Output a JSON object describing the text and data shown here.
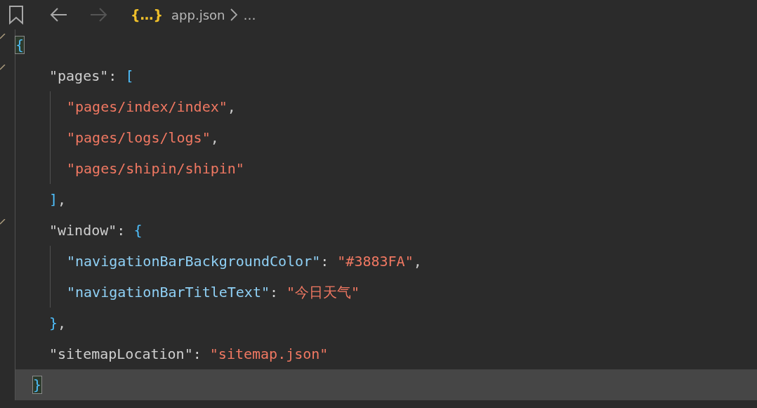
{
  "toolbar": {
    "back": {
      "disabled": false
    },
    "forward": {
      "disabled": true
    }
  },
  "breadcrumb": {
    "file_icon": "{…}",
    "file": "app.json",
    "more": "…"
  },
  "document": {
    "open": [
      {
        "text": "{",
        "kind": "bracket",
        "matched": true
      }
    ],
    "children": [
      {
        "open": [
          {
            "text": "\"pages\"",
            "kind": "top-key"
          },
          {
            "text": ": ",
            "kind": "punct"
          },
          {
            "text": "[",
            "kind": "bracket"
          }
        ],
        "children": [
          {
            "tokens": [
              {
                "text": "\"pages/index/index\"",
                "kind": "string"
              },
              {
                "text": ",",
                "kind": "punct"
              }
            ]
          },
          {
            "tokens": [
              {
                "text": "\"pages/logs/logs\"",
                "kind": "string"
              },
              {
                "text": ",",
                "kind": "punct"
              }
            ]
          },
          {
            "tokens": [
              {
                "text": "\"pages/shipin/shipin\"",
                "kind": "string"
              }
            ]
          }
        ],
        "close": [
          {
            "text": "]",
            "kind": "bracket"
          },
          {
            "text": ",",
            "kind": "punct"
          }
        ]
      },
      {
        "open": [
          {
            "text": "\"window\"",
            "kind": "top-key"
          },
          {
            "text": ": ",
            "kind": "punct"
          },
          {
            "text": "{",
            "kind": "bracket"
          }
        ],
        "children": [
          {
            "tokens": [
              {
                "text": "\"navigationBarBackgroundColor\"",
                "kind": "key"
              },
              {
                "text": ": ",
                "kind": "punct"
              },
              {
                "text": "\"#3883FA\"",
                "kind": "string"
              },
              {
                "text": ",",
                "kind": "punct"
              }
            ]
          },
          {
            "tokens": [
              {
                "text": "\"navigationBarTitleText\"",
                "kind": "key"
              },
              {
                "text": ": ",
                "kind": "punct"
              },
              {
                "text": "\"今日天气\"",
                "kind": "string"
              }
            ]
          }
        ],
        "close": [
          {
            "text": "}",
            "kind": "bracket"
          },
          {
            "text": ",",
            "kind": "punct"
          }
        ]
      },
      {
        "tokens": [
          {
            "text": "\"sitemapLocation\"",
            "kind": "top-key"
          },
          {
            "text": ": ",
            "kind": "punct"
          },
          {
            "text": "\"sitemap.json\"",
            "kind": "string"
          }
        ]
      }
    ],
    "close": [
      {
        "text": "}",
        "kind": "bracket",
        "matched": true
      }
    ],
    "close_current": true
  }
}
